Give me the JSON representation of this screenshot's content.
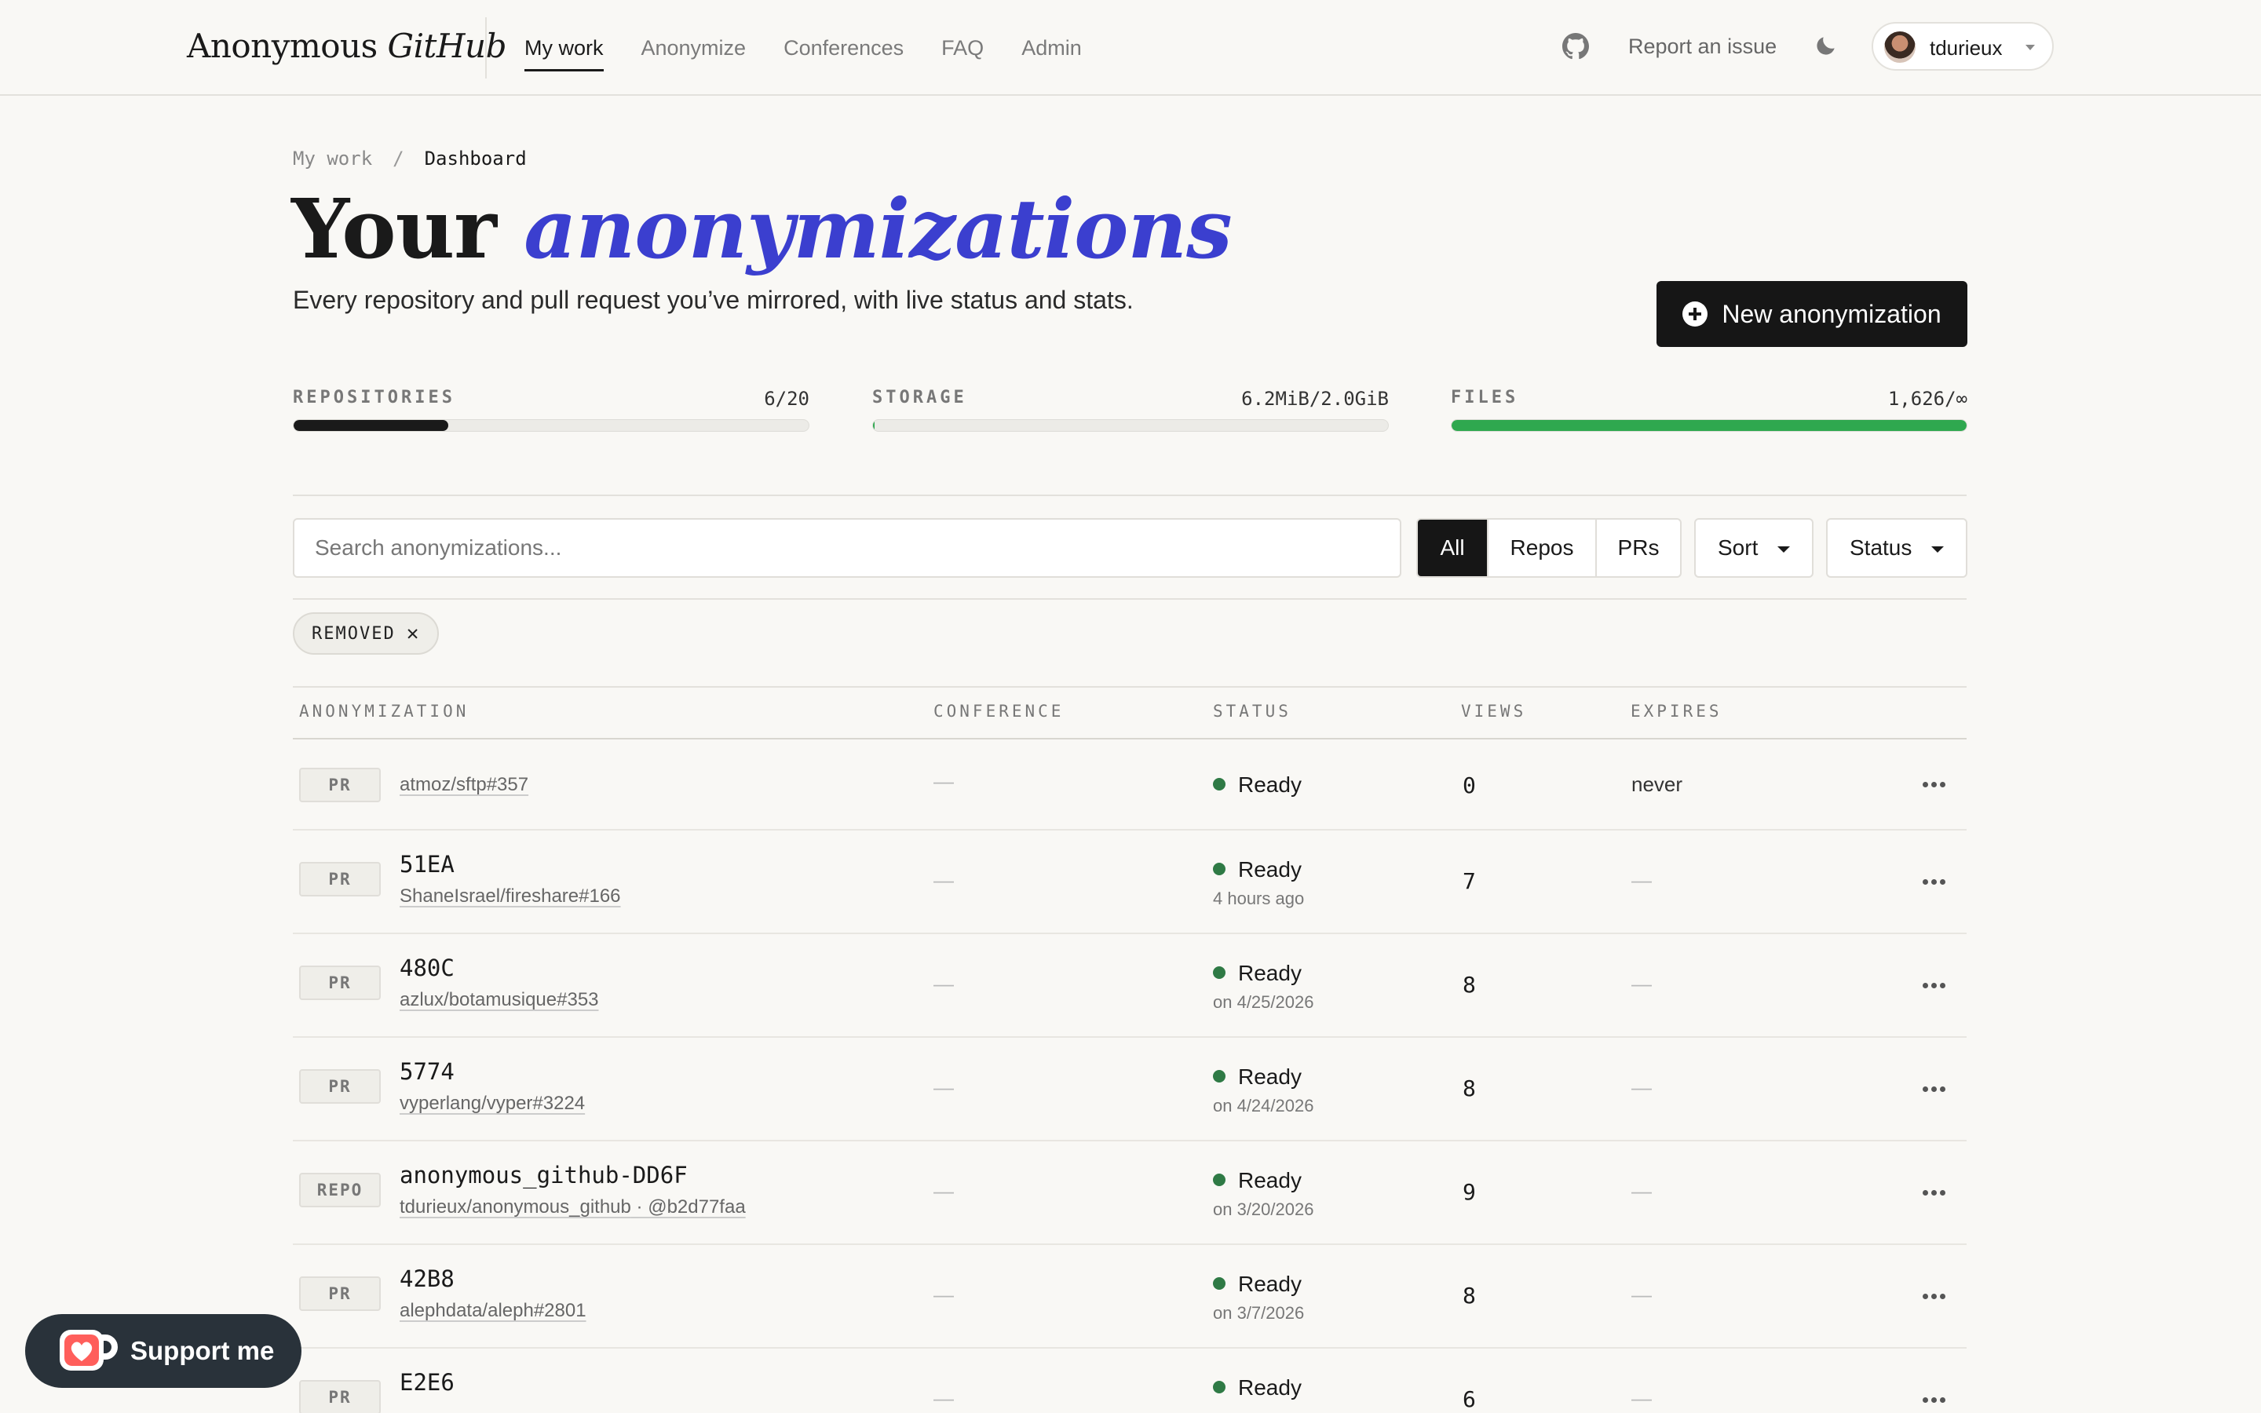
{
  "brand": {
    "main": "Anonymous",
    "italic": "GitHub"
  },
  "nav": [
    {
      "label": "My work",
      "active": true
    },
    {
      "label": "Anonymize",
      "active": false
    },
    {
      "label": "Conferences",
      "active": false
    },
    {
      "label": "FAQ",
      "active": false
    },
    {
      "label": "Admin",
      "active": false
    }
  ],
  "header_actions": {
    "github_icon": "github-icon",
    "report": "Report an issue",
    "theme_icon": "moon-icon",
    "username": "tdurieux"
  },
  "breadcrumb": {
    "parent": "My work",
    "separator": "/",
    "current": "Dashboard"
  },
  "page": {
    "title_plain": "Your",
    "title_accent": "anonymizations",
    "subtitle": "Every repository and pull request you’ve mirrored, with live status and stats.",
    "new_button": "New anonymization"
  },
  "stats": [
    {
      "label": "REPOSITORIES",
      "value": "6/20",
      "fraction": 0.3,
      "color": "#1a1a1a"
    },
    {
      "label": "STORAGE",
      "value": "6.2MiB/2.0GiB",
      "fraction": 0.003,
      "color": "#2fa84f"
    },
    {
      "label": "FILES",
      "value": "1,626/∞",
      "fraction": 1.0,
      "color": "#2fa84f"
    }
  ],
  "toolbar": {
    "search_placeholder": "Search anonymizations...",
    "filters": [
      "All",
      "Repos",
      "PRs"
    ],
    "active_filter": "All",
    "sort_label": "Sort",
    "status_label": "Status"
  },
  "chip": {
    "label": "REMOVED",
    "close": "✕"
  },
  "table": {
    "headers": [
      "ANONYMIZATION",
      "CONFERENCE",
      "STATUS",
      "VIEWS",
      "EXPIRES"
    ],
    "rows": [
      {
        "type": "PR",
        "name": "",
        "source": "atmoz/sftp#357",
        "commit": "",
        "conference": "—",
        "status": "Ready",
        "status_time": "",
        "views": "0",
        "expires": "never"
      },
      {
        "type": "PR",
        "name": "51EA",
        "source": "ShaneIsrael/fireshare#166",
        "commit": "",
        "conference": "—",
        "status": "Ready",
        "status_time": "4 hours ago",
        "views": "7",
        "expires": "—"
      },
      {
        "type": "PR",
        "name": "480C",
        "source": "azlux/botamusique#353",
        "commit": "",
        "conference": "—",
        "status": "Ready",
        "status_time": "on 4/25/2026",
        "views": "8",
        "expires": "—"
      },
      {
        "type": "PR",
        "name": "5774",
        "source": "vyperlang/vyper#3224",
        "commit": "",
        "conference": "—",
        "status": "Ready",
        "status_time": "on 4/24/2026",
        "views": "8",
        "expires": "—"
      },
      {
        "type": "REPO",
        "name": "anonymous_github-DD6F",
        "source": "tdurieux/anonymous_github",
        "commit": " · @b2d77faa",
        "conference": "—",
        "status": "Ready",
        "status_time": "on 3/20/2026",
        "views": "9",
        "expires": "—"
      },
      {
        "type": "PR",
        "name": "42B8",
        "source": "alephdata/aleph#2801",
        "commit": "",
        "conference": "—",
        "status": "Ready",
        "status_time": "on 3/7/2026",
        "views": "8",
        "expires": "—"
      },
      {
        "type": "PR",
        "name": "E2E6",
        "source": "",
        "commit": "",
        "conference": "—",
        "status": "Ready",
        "status_time": "",
        "views": "6",
        "expires": "—"
      }
    ]
  },
  "support": {
    "label": "Support me",
    "icon": "kofi-cup-icon"
  },
  "colors": {
    "accent": "#3b3fcf",
    "status_ready": "#2f7a45",
    "files_bar": "#2fa84f"
  }
}
